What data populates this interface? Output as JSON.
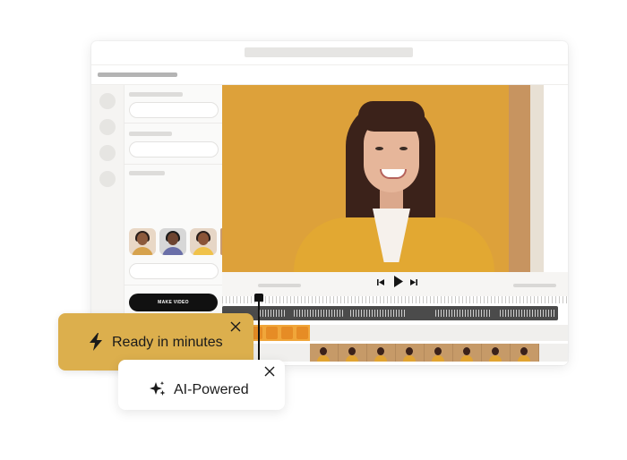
{
  "app": {
    "make_video_label": "MAKE VIDEO"
  },
  "player": {
    "prev_icon": "skip-previous-icon",
    "play_icon": "play-icon",
    "next_icon": "skip-next-icon"
  },
  "badges": {
    "ready": {
      "label": "Ready in minutes",
      "icon": "lightning-bolt-icon",
      "close_icon": "close-icon"
    },
    "ai": {
      "label": "AI-Powered",
      "icon": "sparkles-icon",
      "close_icon": "close-icon"
    }
  },
  "colors": {
    "accent_gold": "#dcaf4d",
    "button_dark": "#111111",
    "video_bg": "#dda13a"
  }
}
